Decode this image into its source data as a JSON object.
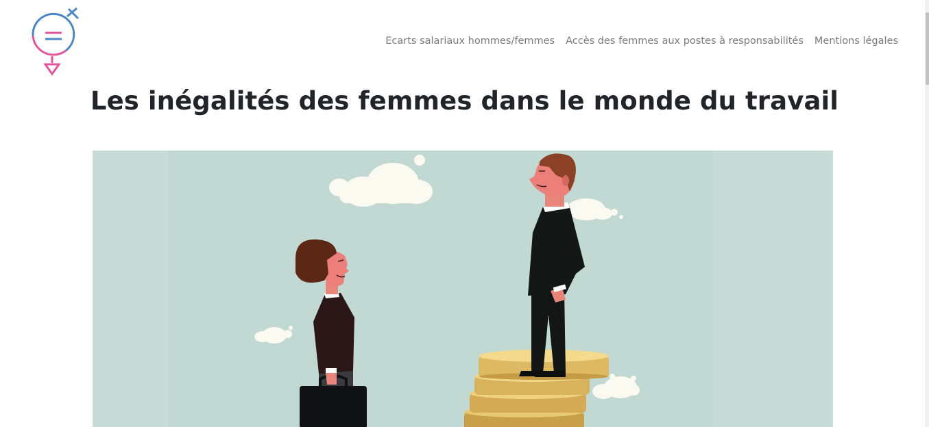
{
  "header": {
    "logo_name": "gender-equality-logo",
    "nav": [
      {
        "label": "Ecarts salariaux hommes/femmes"
      },
      {
        "label": "Accès des femmes aux postes à responsabilités"
      },
      {
        "label": "Mentions légales"
      }
    ]
  },
  "main": {
    "title": "Les inégalités des femmes dans le monde du travail",
    "hero_image": "woman-and-man-on-coin-stack-illustration"
  },
  "colors": {
    "logo_blue": "#4a86c5",
    "logo_pink": "#e0559c",
    "hero_bg": "#c7dcd6",
    "nav_text": "#7a7a7a",
    "title_text": "#212529"
  }
}
